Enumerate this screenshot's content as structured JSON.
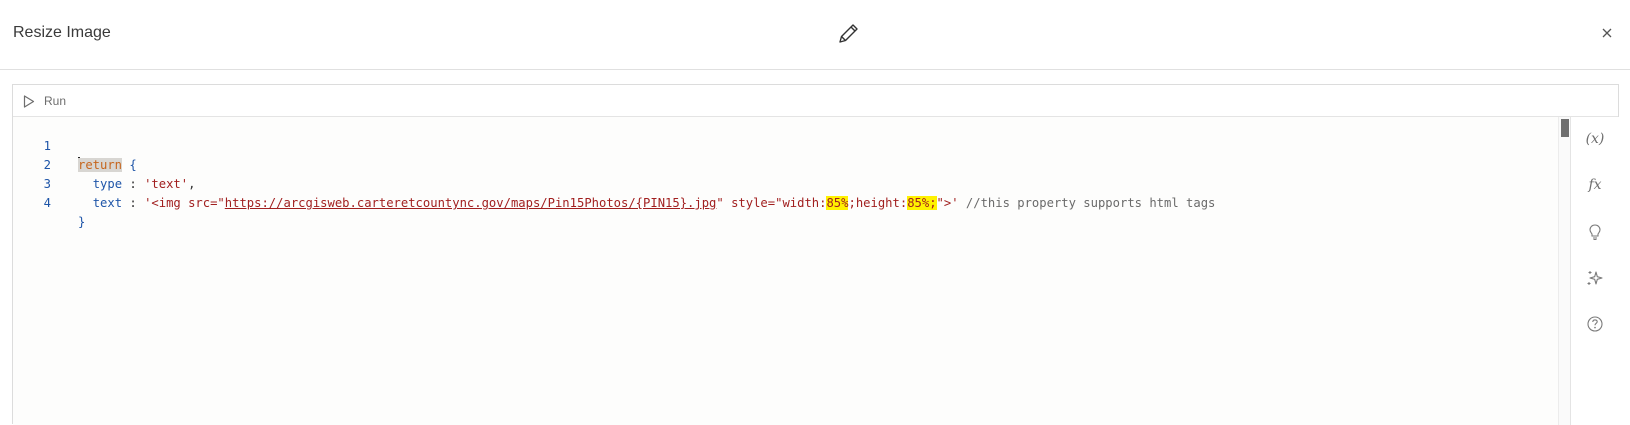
{
  "dialog": {
    "title": "Resize Image",
    "edit_icon": "pencil-icon",
    "close_icon": "close-icon"
  },
  "toolbar": {
    "run_label": "Run"
  },
  "editor": {
    "line_numbers": [
      "1",
      "2",
      "3",
      "4"
    ],
    "line1": {
      "keyword": "return",
      "brace": " {"
    },
    "line2": {
      "indent": "  ",
      "prop": "type",
      "sep": " : ",
      "value": "'text'",
      "end": ","
    },
    "line3": {
      "indent": "  ",
      "prop": "text",
      "sep": " : ",
      "str_open": "'<img src=\"",
      "url": "https://arcgisweb.carteretcountync.gov/maps/Pin15Photos/{PIN15}.jpg",
      "str_mid1": "\" style=\"width:",
      "hl1": "85%",
      "str_mid2": ";height:",
      "hl2": "85%;",
      "str_close": "\">'",
      "comment": " //this property supports html tags"
    },
    "line4": {
      "brace": "}"
    }
  },
  "sidebar": {
    "variables_label": "(x)",
    "functions_label": "fx",
    "icons": [
      "variables-icon",
      "functions-icon",
      "suggestions-icon",
      "assistant-icon",
      "help-icon"
    ]
  },
  "colors": {
    "keyword": "#c6651c",
    "property": "#1e55a8",
    "string": "#a11f1f",
    "highlight": "#fff200",
    "comment": "#6a6a6a"
  }
}
